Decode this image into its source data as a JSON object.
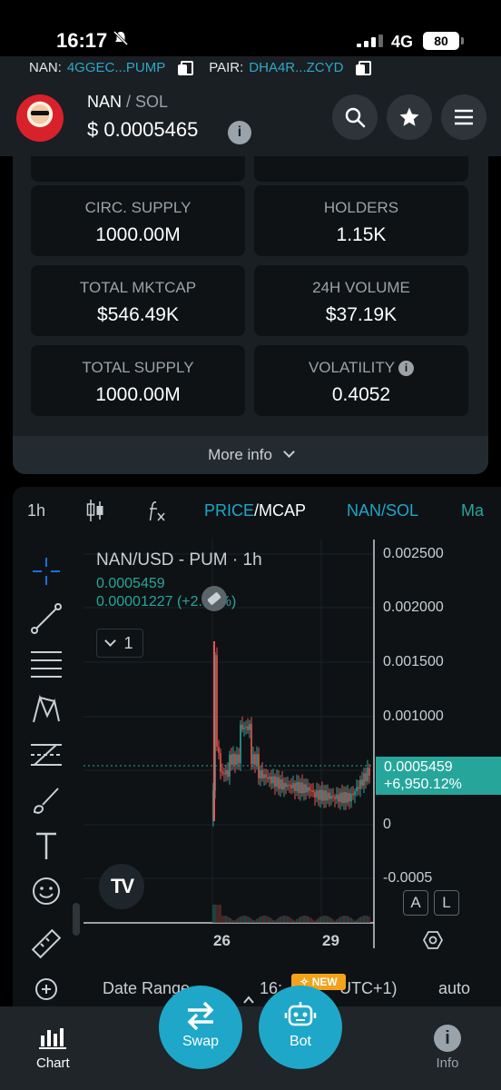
{
  "status_bar": {
    "time": "16:17",
    "network": "4G",
    "battery": "80"
  },
  "header": {
    "token_label": "NAN:",
    "token_address": "4GGEC...PUMP",
    "pair_label": "PAIR:",
    "pair_address": "DHA4R...ZCYD",
    "base": "NAN",
    "sep": " / ",
    "quote": "SOL",
    "price": "$ 0.0005465",
    "info_glyph": "i"
  },
  "stats": [
    {
      "label": "CIRC. SUPPLY",
      "value": "1000.00M"
    },
    {
      "label": "HOLDERS",
      "value": "1.15K"
    },
    {
      "label": "TOTAL MKTCAP",
      "value": "$546.49K"
    },
    {
      "label": "24H VOLUME",
      "value": "$37.19K"
    },
    {
      "label": "TOTAL SUPPLY",
      "value": "1000.00M"
    },
    {
      "label": "VOLATILITY",
      "value": "0.4052"
    }
  ],
  "more_info": "More info",
  "chart_toolbar": {
    "interval": "1h",
    "price": "PRICE",
    "slash": "/",
    "mcap": "MCAP",
    "pair": "NAN/SOL",
    "cut": "Ma"
  },
  "chart": {
    "title": "NAN/USD - PUM · 1h",
    "last_price": "0.0005459",
    "change": "0.00001227 (+2.30%)",
    "count": "1",
    "price_tag_value": "0.0005459",
    "price_tag_change": "+6,950.12%",
    "y_ticks": [
      "0.002500",
      "0.002000",
      "0.001500",
      "0.001000",
      "0",
      "-0.0005"
    ],
    "x_ticks": [
      "26",
      "29"
    ],
    "log_btn": "A",
    "log_btn2": "L",
    "date_range": "Date Range",
    "time_prefix": "16:",
    "timezone": "UTC+1)",
    "auto": "auto",
    "new_badge": "NEW"
  },
  "tabs": {
    "chart": "Chart",
    "swap": "Swap",
    "bot": "Bot",
    "info": "Info"
  },
  "colors": {
    "accent": "#1ea7c9",
    "up": "#26a69a",
    "down": "#ef5350",
    "panel": "#1a1f23"
  }
}
